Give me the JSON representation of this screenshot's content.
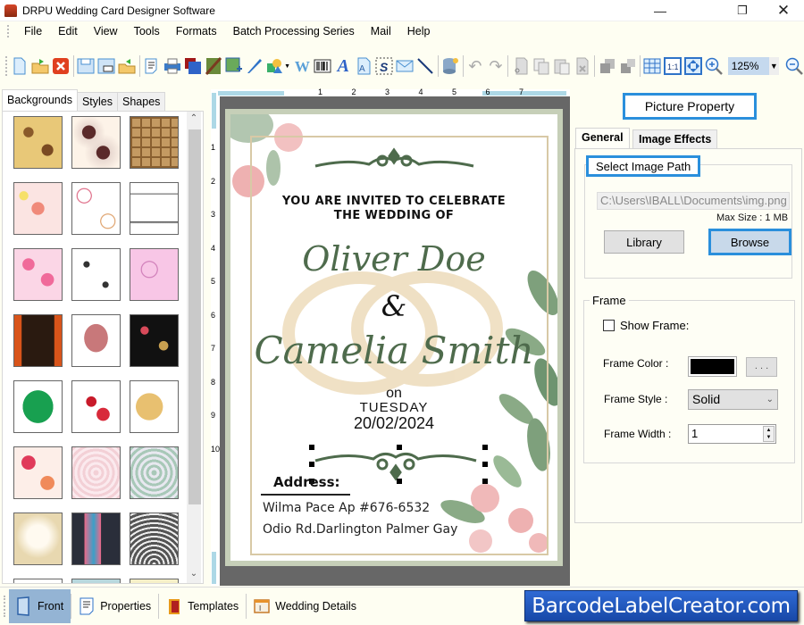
{
  "window": {
    "title": "DRPU Wedding Card Designer Software",
    "minimize_icon": "minimize-icon",
    "maximize_icon": "restore-icon",
    "close_icon": "close-icon"
  },
  "menu": [
    "File",
    "Edit",
    "View",
    "Tools",
    "Formats",
    "Batch Processing Series",
    "Mail",
    "Help"
  ],
  "toolbar": {
    "icons": [
      "new-icon",
      "open-icon",
      "close-file-icon",
      "save-icon",
      "save-as-icon",
      "import-icon",
      "properties-icon",
      "print-icon",
      "print-preview-icon",
      "background-icon",
      "insert-image-icon",
      "pencil-icon",
      "shapes-icon",
      "word-art-icon",
      "barcode-icon",
      "text-icon",
      "letter-icon",
      "signature-icon",
      "mail-icon",
      "line-icon",
      "database-icon",
      "undo-icon",
      "redo-icon",
      "cut-icon",
      "copy-icon",
      "paste-icon",
      "delete-icon",
      "bring-forward-icon",
      "send-backward-icon",
      "grid-icon",
      "actual-size-icon",
      "fit-window-icon",
      "zoom-in-icon",
      "zoom-out-icon"
    ],
    "zoom_level": "125%"
  },
  "left_panel": {
    "tabs": [
      "Backgrounds",
      "Styles",
      "Shapes"
    ],
    "active_tab": "Backgrounds",
    "thumbnails": [
      "golden-floral",
      "paisley-lace",
      "brown-tiles",
      "pink-flowers",
      "heart-outlines",
      "temple-illustration",
      "pink-hearts",
      "dancing-couples",
      "pink-swirls",
      "ganesha-orange",
      "elephant-head",
      "black-floral",
      "leaf-elephant",
      "rose-petals",
      "crescent-star",
      "patterned-hearts",
      "pink-lace",
      "mandala",
      "white-rose-rings",
      "floral-stripe",
      "grey-lace",
      "purple-floral",
      "blue-hearts",
      "heart-border"
    ]
  },
  "ruler": {
    "h_labels": [
      "1",
      "2",
      "3",
      "4",
      "5",
      "6",
      "7"
    ],
    "v_labels": [
      "1",
      "2",
      "3",
      "4",
      "5",
      "6",
      "7",
      "8",
      "9",
      "10"
    ]
  },
  "card": {
    "invite_line1": "YOU ARE INVITED TO CELEBRATE",
    "invite_line2": "THE WEDDING OF",
    "name1": "Oliver  Doe",
    "ampersand": "&",
    "name2": "Camelia  Smith",
    "on": "on",
    "day": "TUESDAY",
    "date": "20/02/2024",
    "address_label": "Address:",
    "address_line1": "Wilma Pace Ap #676-6532",
    "address_line2": "Odio Rd.Darlington Palmer Gay",
    "colors": {
      "script": "#4e6b4c",
      "frame": "#c6cfb8",
      "ornament": "#4e6b4c"
    }
  },
  "right_panel": {
    "title": "Picture Property",
    "tabs": [
      "General",
      "Image Effects"
    ],
    "active_tab": "General",
    "select_image_path_label": "Select Image Path",
    "image_path": "C:\\Users\\IBALL\\Documents\\img.png",
    "max_size": "Max Size : 1 MB",
    "library_button": "Library",
    "browse_button": "Browse",
    "frame": {
      "legend": "Frame",
      "show_frame_label": "Show Frame:",
      "show_frame_checked": false,
      "color_label": "Frame Color :",
      "color_value": "#000000",
      "color_button": ". . .",
      "style_label": "Frame Style :",
      "style_value": "Solid",
      "width_label": "Frame Width :",
      "width_value": "1"
    }
  },
  "bottom_tabs": [
    {
      "label": "Front",
      "icon": "front-page-icon",
      "active": true
    },
    {
      "label": "Properties",
      "icon": "properties-icon",
      "active": false
    },
    {
      "label": "Templates",
      "icon": "templates-icon",
      "active": false
    },
    {
      "label": "Wedding Details",
      "icon": "wedding-details-icon",
      "active": false
    }
  ],
  "brand_banner": "BarcodeLabelCreator.com"
}
